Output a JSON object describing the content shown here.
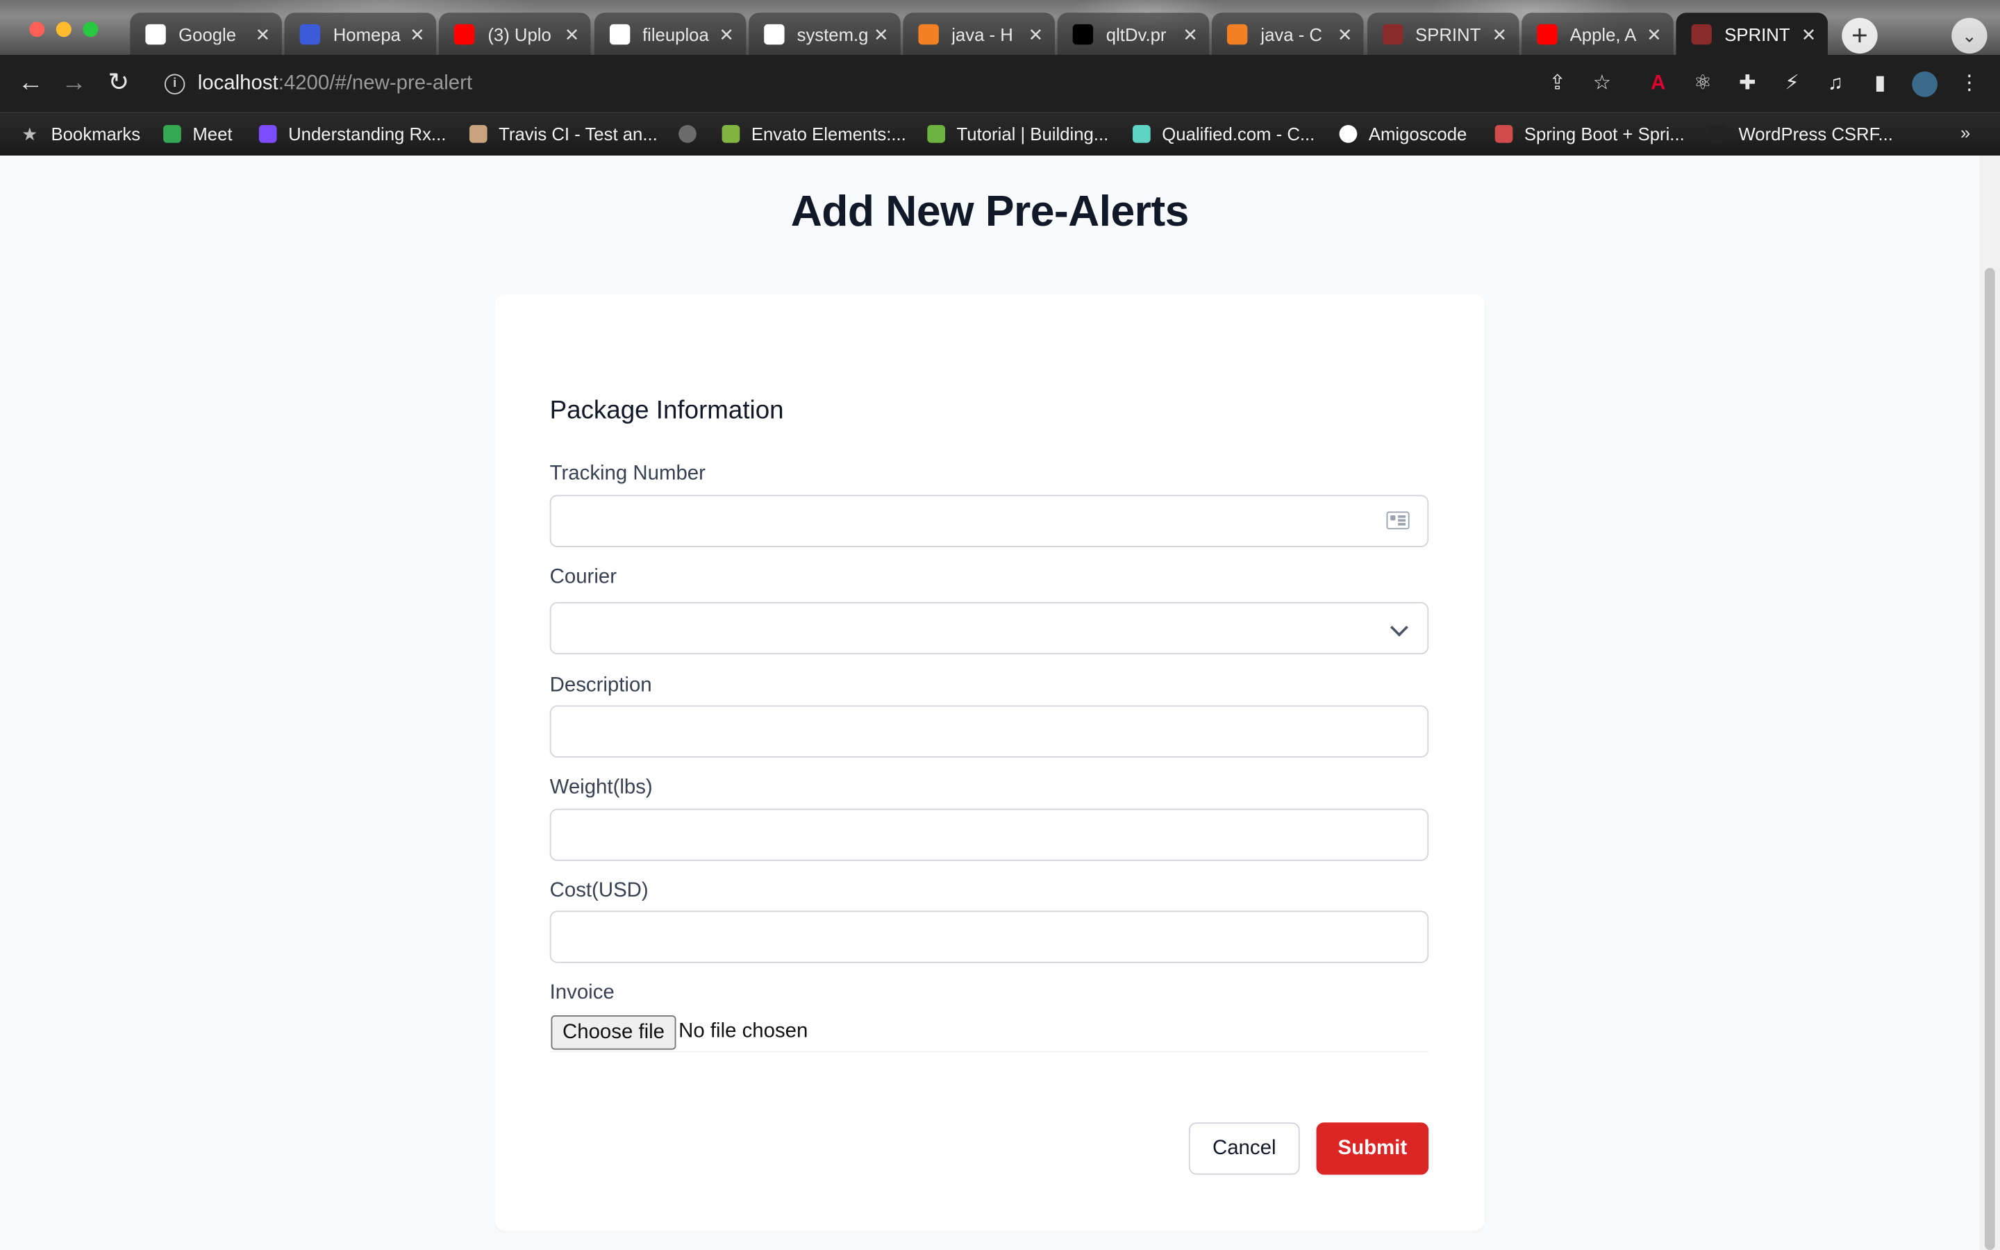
{
  "browser": {
    "tabs": [
      {
        "title": "Google",
        "icon": "google-icon",
        "color": "#ffffff",
        "active": false
      },
      {
        "title": "Homepa",
        "icon": "monitor-icon",
        "color": "#3b5bdb",
        "active": false
      },
      {
        "title": "(3) Uplo",
        "icon": "youtube-icon",
        "color": "#ff0000",
        "active": false
      },
      {
        "title": "fileuploa",
        "icon": "github-icon",
        "color": "#ffffff",
        "active": false
      },
      {
        "title": "system.g",
        "icon": "google-icon",
        "color": "#ffffff",
        "active": false
      },
      {
        "title": "java - H",
        "icon": "stackoverflow-icon",
        "color": "#f48024",
        "active": false
      },
      {
        "title": "qltDv.pr",
        "icon": "info-square-icon",
        "color": "#000000",
        "active": false
      },
      {
        "title": "java - C",
        "icon": "stackoverflow-icon",
        "color": "#f48024",
        "active": false
      },
      {
        "title": "SPRINT",
        "icon": "film-icon",
        "color": "#8b2a2a",
        "active": false
      },
      {
        "title": "Apple, A",
        "icon": "youtube-icon",
        "color": "#ff0000",
        "active": false
      },
      {
        "title": "SPRINT",
        "icon": "film-icon",
        "color": "#8b2a2a",
        "active": true
      }
    ],
    "url_host": "localhost",
    "url_rest": ":4200/#/new-pre-alert",
    "bookmarks": [
      {
        "label": "Bookmarks",
        "color": "#bdbdbd"
      },
      {
        "label": "Meet",
        "color": "#34a853"
      },
      {
        "label": "Understanding Rx...",
        "color": "#7c4dff"
      },
      {
        "label": "Travis CI - Test an...",
        "color": "#c9a27e"
      },
      {
        "label": "",
        "color": "#6b6b6b"
      },
      {
        "label": "Envato Elements:...",
        "color": "#82b541"
      },
      {
        "label": "Tutorial | Building...",
        "color": "#6db33f"
      },
      {
        "label": "Qualified.com - C...",
        "color": "#5fd3c4"
      },
      {
        "label": "Amigoscode",
        "color": "#ffffff"
      },
      {
        "label": "Spring Boot + Spri...",
        "color": "#d04b4b"
      },
      {
        "label": "WordPress CSRF...",
        "color": "#222222"
      }
    ],
    "more": "»"
  },
  "page": {
    "title": "Add New Pre-Alerts"
  },
  "form": {
    "section_title": "Package Information",
    "tracking_label": "Tracking Number",
    "tracking_value": "",
    "courier_label": "Courier",
    "courier_value": "",
    "description_label": "Description",
    "description_value": "",
    "weight_label": "Weight(lbs)",
    "weight_value": "",
    "cost_label": "Cost(USD)",
    "cost_value": "",
    "invoice_label": "Invoice",
    "file_button": "Choose file",
    "file_status": "No file chosen",
    "cancel": "Cancel",
    "submit": "Submit"
  },
  "colors": {
    "submit": "#dc2626",
    "page_bg": "#f8fafc"
  }
}
